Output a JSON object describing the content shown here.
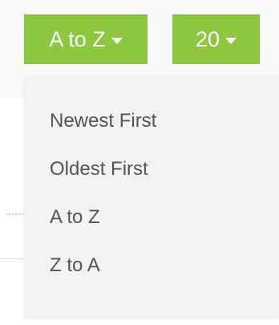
{
  "sort_button": {
    "label": "A to Z"
  },
  "count_button": {
    "label": "20"
  },
  "sort_menu": {
    "options": [
      {
        "label": "Newest First"
      },
      {
        "label": "Oldest First"
      },
      {
        "label": "A to Z"
      },
      {
        "label": "Z to A"
      }
    ]
  },
  "colors": {
    "button_bg": "#8dc63f",
    "button_text": "#ffffff",
    "menu_bg": "#f2f2f2",
    "menu_text": "#555555"
  }
}
